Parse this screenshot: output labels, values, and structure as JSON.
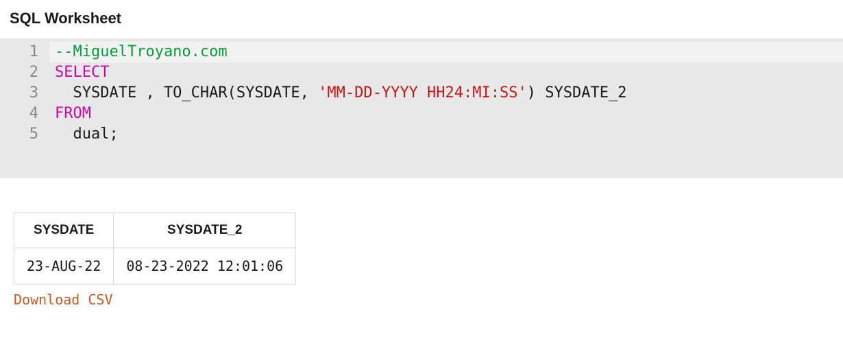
{
  "header": {
    "title": "SQL Worksheet"
  },
  "editor": {
    "line_numbers": [
      "1",
      "2",
      "3",
      "4",
      "5"
    ],
    "lines": {
      "l1_comment": "--MiguelTroyano.com",
      "l2_select": "SELECT",
      "l3_pre": "  SYSDATE , TO_CHAR(SYSDATE, ",
      "l3_str": "'MM-DD-YYYY HH24:MI:SS'",
      "l3_post": ") SYSDATE_2",
      "l4_from": "FROM",
      "l5_body": "  dual;"
    }
  },
  "results": {
    "columns": [
      "SYSDATE",
      "SYSDATE_2"
    ],
    "rows": [
      {
        "c0": "23-AUG-22",
        "c1": "08-23-2022 12:01:06"
      }
    ],
    "download_label": "Download CSV"
  }
}
